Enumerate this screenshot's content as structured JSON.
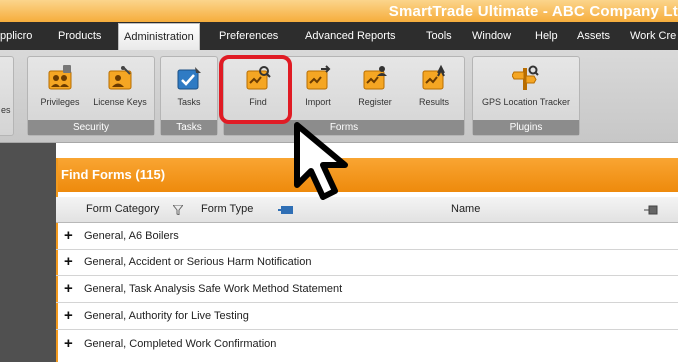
{
  "app_title": "SmartTrade Ultimate - ABC Company Lt",
  "menu": {
    "items": [
      "pplicro",
      "Products",
      "Administration",
      "Preferences",
      "Advanced Reports",
      "Tools",
      "Window",
      "Help",
      "Assets",
      "Work Cre"
    ],
    "active": "Administration"
  },
  "ribbon": {
    "cut_label": "es",
    "groups": {
      "security": {
        "label": "Security",
        "buttons": [
          "Privileges",
          "License Keys"
        ]
      },
      "tasks": {
        "label": "Tasks",
        "buttons": [
          "Tasks"
        ]
      },
      "forms": {
        "label": "Forms",
        "buttons": [
          "Find",
          "Import",
          "Register",
          "Results"
        ]
      },
      "plugins": {
        "label": "Plugins",
        "buttons": [
          "GPS Location Tracker"
        ]
      }
    }
  },
  "panel": {
    "title": "Find Forms (115)",
    "columns": [
      "Form Category",
      "Form Type",
      "Name"
    ],
    "rows": [
      "General, A6 Boilers",
      "General, Accident or Serious Harm Notification",
      "General, Task Analysis Safe Work Method Statement",
      "General, Authority for Live Testing",
      "General, Completed Work Confirmation"
    ]
  },
  "colors": {
    "accent": "#f29a1e",
    "highlight": "#e01b24",
    "menubar": "#2d2d2d"
  },
  "icons": [
    "privileges-icon",
    "license-keys-icon",
    "tasks-icon",
    "find-icon",
    "import-icon",
    "register-icon",
    "results-icon",
    "gps-icon",
    "filter-icon",
    "pin-icon",
    "mouse-pointer-icon"
  ]
}
